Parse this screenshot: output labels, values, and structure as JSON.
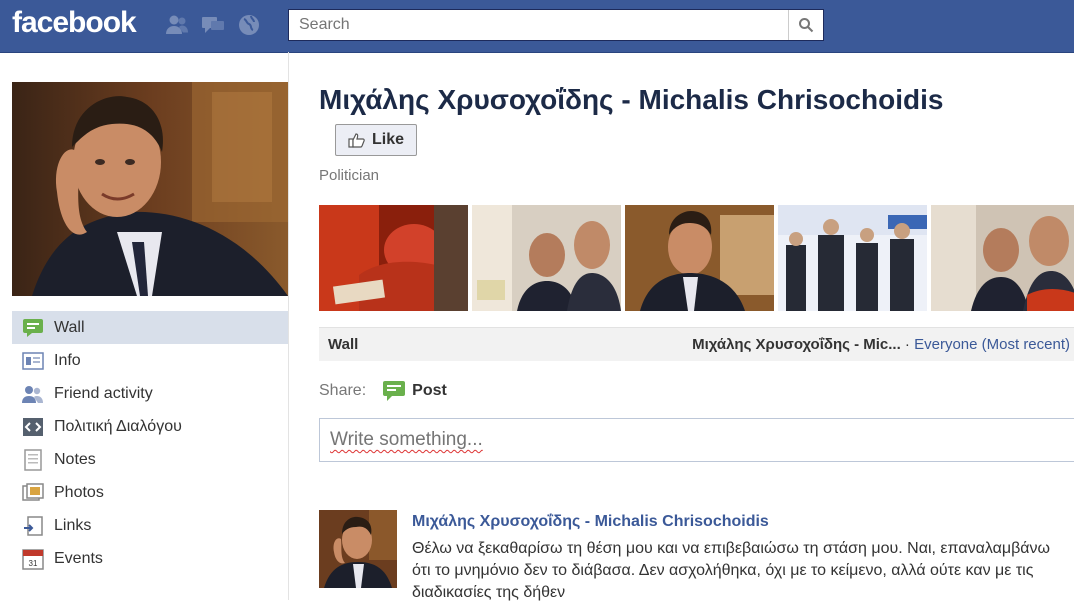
{
  "topbar": {
    "logo": "facebook",
    "search_placeholder": "Search",
    "jewels": [
      "friend-requests-icon",
      "messages-icon",
      "notifications-icon"
    ],
    "brand_color": "#3b5998"
  },
  "sidebar": {
    "items": [
      {
        "label": "Wall",
        "icon": "wall-icon",
        "active": true
      },
      {
        "label": "Info",
        "icon": "info-icon"
      },
      {
        "label": "Friend activity",
        "icon": "friends-icon"
      },
      {
        "label": "Πολιτική Διαλόγου",
        "icon": "code-icon"
      },
      {
        "label": "Notes",
        "icon": "notes-icon"
      },
      {
        "label": "Photos",
        "icon": "photos-icon"
      },
      {
        "label": "Links",
        "icon": "links-icon"
      },
      {
        "label": "Events",
        "icon": "events-icon"
      }
    ]
  },
  "page": {
    "title": "Μιχάλης Χρυσοχοΐδης - Michalis Chrisochoidis",
    "like_label": "Like",
    "category": "Politician"
  },
  "wallbar": {
    "left": "Wall",
    "right_bold": "Μιχάλης Χρυσοχοΐδης - Mic...",
    "separator": " · ",
    "right_link": "Everyone (Most recent)"
  },
  "share": {
    "label": "Share:",
    "post_label": "Post"
  },
  "composer": {
    "placeholder": "Write something..."
  },
  "story": {
    "author": "Μιχάλης Χρυσοχοΐδης - Michalis Chrisochoidis",
    "text": "Θέλω να ξεκαθαρίσω τη θέση μου και να επιβεβαιώσω τη στάση μου. Ναι, επαναλαμβάνω ότι το μνημόνιο δεν το διάβασα. Δεν ασχολήθηκα, όχι με το κείμενο, αλλά ούτε καν με τις διαδικασίες της δήθεν"
  }
}
